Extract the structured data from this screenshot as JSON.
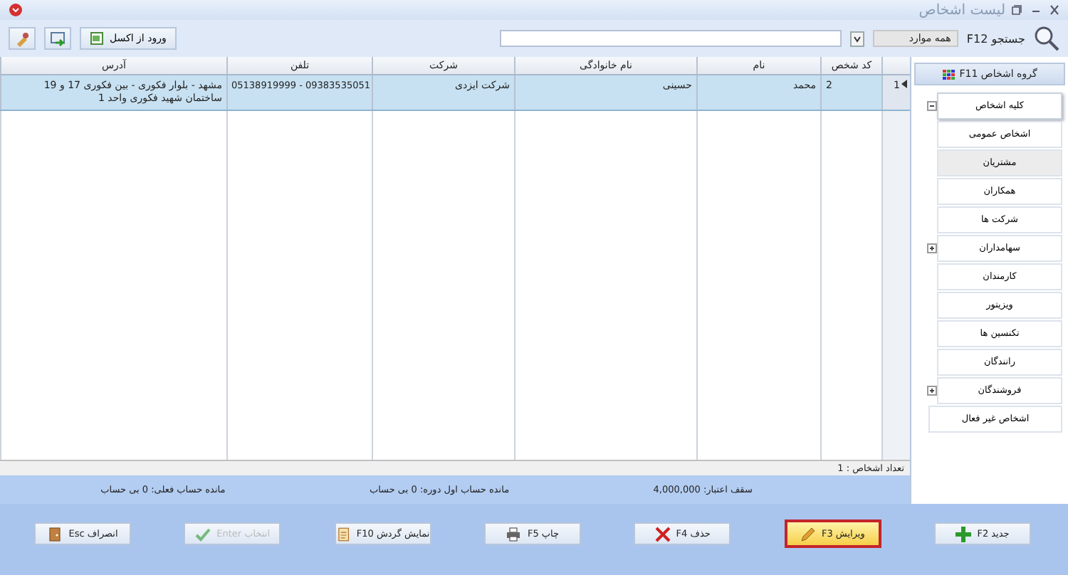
{
  "window": {
    "title": "لیست اشخاص"
  },
  "toolbar": {
    "buttons": [
      {
        "label": "ورود از اکسل",
        "kind": "excel"
      },
      {
        "kind": "export"
      },
      {
        "kind": "settings"
      }
    ]
  },
  "search": {
    "label": "جستجو F12",
    "scope": "همه موارد"
  },
  "sidebar": {
    "title": "گروه اشخاص F11",
    "items": [
      {
        "label": "کلیه اشخاص",
        "selected": true,
        "highlighted": false,
        "kind": "group",
        "expanded": true
      },
      {
        "label": "اشخاص عمومی",
        "selected": false,
        "highlighted": false,
        "kind": "leaf"
      },
      {
        "label": "مشتریان",
        "selected": false,
        "highlighted": true,
        "kind": "leaf"
      },
      {
        "label": "همکاران",
        "selected": false,
        "highlighted": false,
        "kind": "leaf"
      },
      {
        "label": "شرکت ها",
        "selected": false,
        "highlighted": false,
        "kind": "leaf"
      },
      {
        "label": "سهامداران",
        "selected": false,
        "highlighted": false,
        "kind": "group",
        "expanded": false
      },
      {
        "label": "کارمندان",
        "selected": false,
        "highlighted": false,
        "kind": "leaf"
      },
      {
        "label": "ویزیتور",
        "selected": false,
        "highlighted": false,
        "kind": "leaf"
      },
      {
        "label": "تکنسین ها",
        "selected": false,
        "highlighted": false,
        "kind": "leaf"
      },
      {
        "label": "رانندگان",
        "selected": false,
        "highlighted": false,
        "kind": "leaf"
      },
      {
        "label": "فروشندگان",
        "selected": false,
        "highlighted": false,
        "kind": "group",
        "expanded": false
      },
      {
        "label": "اشخاص غیر فعال",
        "selected": false,
        "highlighted": false,
        "kind": "standalone"
      }
    ]
  },
  "table": {
    "columns": [
      "کد شخص",
      "نام",
      "نام خانوادگی",
      "شرکت",
      "تلفن",
      "آدرس"
    ],
    "rows": [
      {
        "indicator": "1",
        "current": true,
        "selected": true,
        "cells": [
          "2",
          "محمد",
          "حسینی",
          "شرکت ایزدی",
          "09383535051 - 05138919999",
          "مشهد - بلوار فکوری - بین فکوری 17 و 19 ساختمان شهید فکوری واحد 1"
        ]
      }
    ]
  },
  "status_bar": {
    "count": "تعداد اشخاص : 1"
  },
  "summary": [
    "سقف اعتبار: 4,000,000",
    "مانده حساب اول دوره: 0 بی حساب",
    "مانده حساب فعلی: 0 بی حساب"
  ],
  "buttons": [
    {
      "label": "جدید F2",
      "kind": "add",
      "disabled": false,
      "focused": false
    },
    {
      "label": "ویرایش F3",
      "kind": "edit",
      "disabled": false,
      "focused": true
    },
    {
      "label": "حذف F4",
      "kind": "delete",
      "disabled": false,
      "focused": false
    },
    {
      "label": "چاپ F5",
      "kind": "print",
      "disabled": false,
      "focused": false
    },
    {
      "label": "نمایش گردش F10",
      "kind": "history",
      "disabled": false,
      "focused": false
    },
    {
      "label": "انتخاب Enter",
      "kind": "select",
      "disabled": true,
      "focused": false
    },
    {
      "label": "انصراف Esc",
      "kind": "cancel",
      "disabled": false,
      "focused": false
    }
  ]
}
